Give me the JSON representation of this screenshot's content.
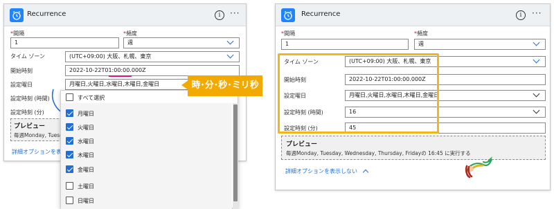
{
  "left": {
    "title": "Recurrence",
    "interval_label": "間隔",
    "interval_value": "1",
    "frequency_label": "頻度",
    "frequency_value": "週",
    "timezone_label": "タイム ゾーン",
    "timezone_value": "(UTC+09:00) 大阪、札幌、東京",
    "start_time_label": "開始時刻",
    "start_time_value": "2022-10-22T01:00:00.000Z",
    "weekdays_label": "設定曜日",
    "weekdays_value": "月曜日,火曜日,水曜日,木曜日,金曜日",
    "hours_label": "設定時刻 (時間)",
    "minutes_label": "設定時刻 (分)",
    "preview_title": "プレビュー",
    "preview_text": "毎週Monday, Tuesday, W",
    "advanced_link": "詳細オプションを表示し"
  },
  "dropdown": {
    "select_all": "すべて選択",
    "items": [
      {
        "label": "月曜日",
        "checked": true
      },
      {
        "label": "火曜日",
        "checked": true
      },
      {
        "label": "水曜日",
        "checked": true
      },
      {
        "label": "木曜日",
        "checked": true
      },
      {
        "label": "金曜日",
        "checked": true
      },
      {
        "label": "土曜日",
        "checked": false
      },
      {
        "label": "日曜日",
        "checked": false
      }
    ]
  },
  "callout": "時･分･秒･ミリ秒",
  "right": {
    "title": "Recurrence",
    "interval_label": "間隔",
    "interval_value": "1",
    "frequency_label": "頻度",
    "frequency_value": "週",
    "timezone_label": "タイム ゾーン",
    "timezone_value": "(UTC+09:00) 大阪、札幌、東京",
    "start_time_label": "開始時刻",
    "start_time_value": "2022-10-22T01:00:00.000Z",
    "weekdays_label": "設定曜日",
    "weekdays_value": "月曜日,火曜日,水曜日,木曜日,金曜日",
    "hours_label": "設定時刻 (時間)",
    "hours_value": "16",
    "minutes_label": "設定時刻 (分)",
    "minutes_value": "45",
    "preview_title": "プレビュー",
    "preview_text": "毎週Monday, Tuesday, Wednesday, Thursday, Fridayの 16:45 に実行する",
    "advanced_link": "詳細オプションを表示しない"
  },
  "colors": {
    "accent": "#1f85ff",
    "highlight": "#f2b51d",
    "callout": "#f2a900",
    "underline": "#e0107a"
  }
}
